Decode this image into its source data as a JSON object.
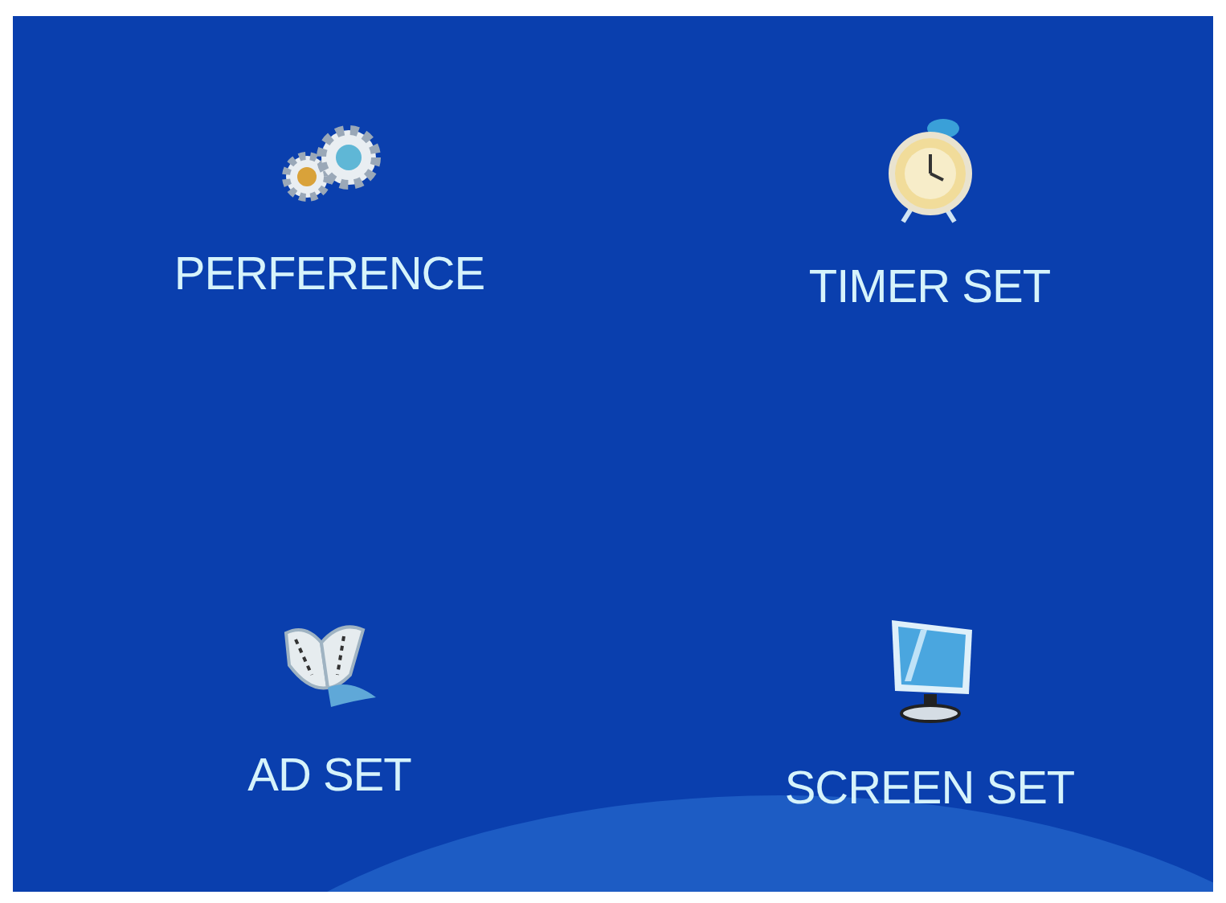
{
  "menu_items": [
    {
      "kind": "gears",
      "label": "PERFERENCE"
    },
    {
      "kind": "clock",
      "label": "TIMER SET"
    },
    {
      "kind": "film",
      "label": "AD SET"
    },
    {
      "kind": "monitor",
      "label": "SCREEN SET"
    }
  ]
}
